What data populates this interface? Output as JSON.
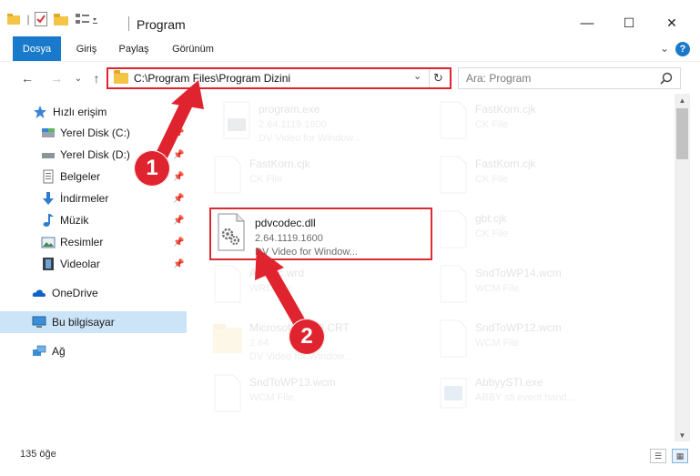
{
  "window": {
    "title": "Program",
    "minimize": "—",
    "maximize": "☐",
    "close": "✕"
  },
  "ribbon": {
    "tabs": [
      "Dosya",
      "Giriş",
      "Paylaş",
      "Görünüm"
    ],
    "expand": "⌄",
    "help": "?"
  },
  "address": {
    "path": "C:\\Program Files\\Program Dizini",
    "dropdown": "⌄",
    "refresh": "↻"
  },
  "search": {
    "placeholder": "Ara: Program"
  },
  "nav": {
    "back": "←",
    "forward": "→",
    "recent": "⌄",
    "up": "↑"
  },
  "sidebar": {
    "items": [
      {
        "label": "Hızlı erişim",
        "icon": "star-icon"
      },
      {
        "label": "Yerel Disk (C:)",
        "icon": "drive-icon"
      },
      {
        "label": "Yerel Disk (D:)",
        "icon": "drive-icon"
      },
      {
        "label": "Belgeler",
        "icon": "documents-icon"
      },
      {
        "label": "İndirmeler",
        "icon": "downloads-icon"
      },
      {
        "label": "Müzik",
        "icon": "music-icon"
      },
      {
        "label": "Resimler",
        "icon": "pictures-icon"
      },
      {
        "label": "Videolar",
        "icon": "videos-icon"
      },
      {
        "label": "OneDrive",
        "icon": "cloud-icon"
      },
      {
        "label": "Bu bilgisayar",
        "icon": "computer-icon"
      },
      {
        "label": "Ağ",
        "icon": "network-icon"
      }
    ],
    "pin": "📌"
  },
  "files": [
    {
      "name": "program.exe",
      "line1": "2.64.1119.1600",
      "line2": "DV Video for Window...",
      "icon": "exe-icon"
    },
    {
      "name": "FastKorn.cjk",
      "line1": "CK File",
      "line2": "",
      "icon": "file-icon"
    },
    {
      "name": "FastKorn.cjk",
      "line1": "CK File",
      "line2": "",
      "icon": "file-icon"
    },
    {
      "name": "FastKorn.cjk",
      "line1": "CK File",
      "line2": "",
      "icon": "file-icon"
    },
    {
      "name": "pdvcodec.dll",
      "line1": "2.64.1119.1600",
      "line2": "DV Video for Window...",
      "icon": "dll-icon"
    },
    {
      "name": "gbt.cjk",
      "line1": "CK File",
      "line2": "",
      "icon": "file-icon"
    },
    {
      "name": "Aboutc.wrd",
      "line1": "WRD File",
      "line2": "",
      "icon": "file-icon"
    },
    {
      "name": "SndToWP14.wcm",
      "line1": "WCM File",
      "line2": "",
      "icon": "file-icon"
    },
    {
      "name": "Microsoft.VC90.CRT",
      "line1": "2.64",
      "line2": "DV Video for Window...",
      "icon": "folder-icon"
    },
    {
      "name": "SndToWP12.wcm",
      "line1": "WCM File",
      "line2": "",
      "icon": "file-icon"
    },
    {
      "name": "SndToWP13.wcm",
      "line1": "WCM File",
      "line2": "",
      "icon": "file-icon"
    },
    {
      "name": "AbbyySTI.exe",
      "line1": "ABBY sti event hand...",
      "line2": "",
      "icon": "exe-icon"
    }
  ],
  "status": {
    "count": "135 öğe"
  },
  "annotations": [
    "1",
    "2"
  ],
  "colors": {
    "accent": "#1979ca",
    "highlight": "#e0242f",
    "selection": "#cce4f7"
  }
}
